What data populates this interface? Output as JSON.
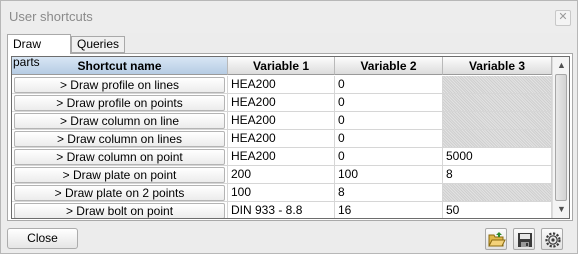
{
  "window": {
    "title": "User shortcuts",
    "close_glyph": "✕"
  },
  "tabs": [
    {
      "label": "Draw parts",
      "active": true
    },
    {
      "label": "Queries",
      "active": false
    }
  ],
  "grid": {
    "columns": [
      "Shortcut name",
      "Variable 1",
      "Variable 2",
      "Variable 3"
    ],
    "rows": [
      {
        "name": "> Draw profile on lines",
        "v1": "HEA200",
        "v2": "0",
        "v3": "",
        "v3_disabled": true
      },
      {
        "name": "> Draw profile on points",
        "v1": "HEA200",
        "v2": "0",
        "v3": "",
        "v3_disabled": true
      },
      {
        "name": "> Draw column on line",
        "v1": "HEA200",
        "v2": "0",
        "v3": "",
        "v3_disabled": true
      },
      {
        "name": "> Draw column on lines",
        "v1": "HEA200",
        "v2": "0",
        "v3": "",
        "v3_disabled": true
      },
      {
        "name": "> Draw column on point",
        "v1": "HEA200",
        "v2": "0",
        "v3": "5000",
        "v3_disabled": false
      },
      {
        "name": "> Draw plate on point",
        "v1": "200",
        "v2": "100",
        "v3": "8",
        "v3_disabled": false
      },
      {
        "name": "> Draw plate on 2 points",
        "v1": "100",
        "v2": "8",
        "v3": "",
        "v3_disabled": true
      },
      {
        "name": "> Draw bolt on point",
        "v1": "DIN 933 - 8.8",
        "v2": "16",
        "v3": "50",
        "v3_disabled": false
      }
    ]
  },
  "scrollbar": {
    "up_glyph": "▲",
    "down_glyph": "▼"
  },
  "footer": {
    "close_label": "Close",
    "icons": [
      "open-folder-icon",
      "save-icon",
      "settings-icon"
    ]
  },
  "colors": {
    "header_selected": "#c7d8ec",
    "disabled_cell": "#d9d9d9",
    "title_text": "#8a8a8a"
  }
}
